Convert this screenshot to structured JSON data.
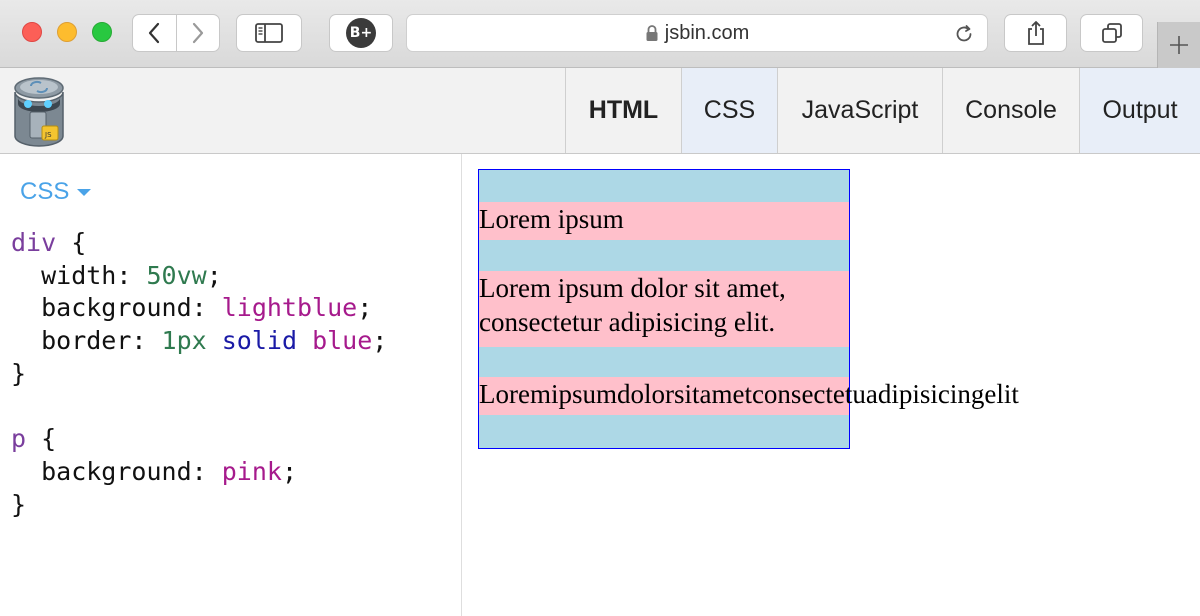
{
  "browser": {
    "url": "jsbin.com",
    "extension_badge": "B+"
  },
  "toolbar": {
    "tabs": [
      {
        "label": "HTML",
        "active": false,
        "bold": true
      },
      {
        "label": "CSS",
        "active": true,
        "bold": false
      },
      {
        "label": "JavaScript",
        "active": false,
        "bold": false
      },
      {
        "label": "Console",
        "active": false,
        "bold": false
      },
      {
        "label": "Output",
        "active": true,
        "bold": false
      }
    ]
  },
  "editor": {
    "language_label": "CSS",
    "code_lines": [
      [
        {
          "t": "div",
          "c": "sel"
        },
        {
          "t": " {",
          "c": ""
        }
      ],
      [
        {
          "t": "  width: ",
          "c": ""
        },
        {
          "t": "50vw",
          "c": "num"
        },
        {
          "t": ";",
          "c": ""
        }
      ],
      [
        {
          "t": "  background: ",
          "c": ""
        },
        {
          "t": "lightblue",
          "c": "pink"
        },
        {
          "t": ";",
          "c": ""
        }
      ],
      [
        {
          "t": "  border: ",
          "c": ""
        },
        {
          "t": "1px",
          "c": "num"
        },
        {
          "t": " ",
          "c": ""
        },
        {
          "t": "solid",
          "c": "blue"
        },
        {
          "t": " ",
          "c": ""
        },
        {
          "t": "blue",
          "c": "pink"
        },
        {
          "t": ";",
          "c": ""
        }
      ],
      [
        {
          "t": "}",
          "c": ""
        }
      ],
      [
        {
          "t": "",
          "c": ""
        }
      ],
      [
        {
          "t": "p",
          "c": "sel"
        },
        {
          "t": " {",
          "c": ""
        }
      ],
      [
        {
          "t": "  background: ",
          "c": ""
        },
        {
          "t": "pink",
          "c": "pink"
        },
        {
          "t": ";",
          "c": ""
        }
      ],
      [
        {
          "t": "}",
          "c": ""
        }
      ]
    ]
  },
  "output": {
    "paragraphs": [
      "Lorem ipsum",
      "Lorem ipsum dolor sit amet, consectetur adipisicing elit.",
      "Loremipsumdolorsitametconsectetuadipisicingelit"
    ]
  },
  "colors": {
    "div_background": "#add8e6",
    "div_border": "#0000ff",
    "p_background": "#ffc0cb",
    "accent": "#4aa3e8"
  }
}
